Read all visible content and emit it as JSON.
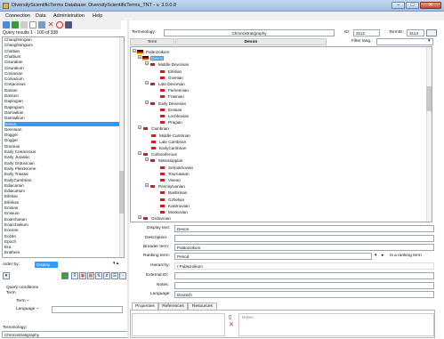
{
  "window": {
    "title": "DiversityScientificTerms  Database: DiversityScientificTerms_TNT  -  v. 3.0.0.8"
  },
  "menu": {
    "items": [
      "Connection",
      "Data",
      "Administration",
      "Help"
    ]
  },
  "query": {
    "results_label": "Query results  1 - 100 of 338",
    "items": [
      "Changhsingian",
      "Changhsingium",
      "Chattian",
      "Chattium",
      "Cisuralian",
      "Cisuralium",
      "Coniacian",
      "Coniacium",
      "Cretaceous",
      "Danian",
      "Danium",
      "Dapingian",
      "Dapingium",
      "Darriwilian",
      "Darriwilium",
      "Devon",
      "Devonian",
      "Dogger",
      "Dogger",
      "Drumian",
      "Early Cretaceous",
      "Early Jurassic",
      "Early Ordovician",
      "Early Pleistocene",
      "Early Triassic",
      "EarlyCambrian",
      "Ediacarian",
      "Ediacarium",
      "Eifelian",
      "Eifelium",
      "Emsian",
      "Emsium",
      "Eoarchaean",
      "Eoarchaikum",
      "Eocene",
      "Eozän",
      "Epoch",
      "Era",
      "Erathem"
    ],
    "selected": "Devon",
    "order_by_label": "order by:",
    "order_by_value": "Display Text",
    "conditions_label": "Query conditions",
    "term_label": "Term",
    "term_cond": "Term  ~",
    "language_cond": "Language  ~",
    "terminology_label": "Terminology:",
    "terminology_value": "Chronostratigraphy"
  },
  "header": {
    "terminology_label": "Terminology:",
    "terminology_value": "Chronostratigraphy",
    "id_label": "ID:",
    "id_value": "3112",
    "termid_label": "TermID:",
    "termid_value": "3113",
    "term_label": "Term",
    "term_value": "Devon",
    "filter_label": "Filter lang.:"
  },
  "tree": [
    {
      "label": "Paläozoikum",
      "depth": 0,
      "expander": "−",
      "flag": "de",
      "selected": false
    },
    {
      "label": "Devon",
      "depth": 1,
      "expander": "−",
      "flag": "de",
      "selected": true
    },
    {
      "label": "Middle Devonian",
      "depth": 2,
      "expander": "−",
      "flag": "gb",
      "selected": false
    },
    {
      "label": "Eifelian",
      "depth": 3,
      "expander": "",
      "flag": "gb",
      "selected": false
    },
    {
      "label": "Givetian",
      "depth": 3,
      "expander": "",
      "flag": "gb",
      "selected": false
    },
    {
      "label": "Late Devonian",
      "depth": 2,
      "expander": "−",
      "flag": "gb",
      "selected": false
    },
    {
      "label": "Famennian",
      "depth": 3,
      "expander": "",
      "flag": "gb",
      "selected": false
    },
    {
      "label": "Frasnian",
      "depth": 3,
      "expander": "",
      "flag": "gb",
      "selected": false
    },
    {
      "label": "Early Devonian",
      "depth": 2,
      "expander": "−",
      "flag": "gb",
      "selected": false
    },
    {
      "label": "Emsian",
      "depth": 3,
      "expander": "",
      "flag": "gb",
      "selected": false
    },
    {
      "label": "Lochkovian",
      "depth": 3,
      "expander": "",
      "flag": "gb",
      "selected": false
    },
    {
      "label": "Pragian",
      "depth": 3,
      "expander": "",
      "flag": "gb",
      "selected": false
    },
    {
      "label": "Cambrian",
      "depth": 1,
      "expander": "−",
      "flag": "gb",
      "selected": false
    },
    {
      "label": "Middle Cambrian",
      "depth": 2,
      "expander": "",
      "flag": "gb",
      "selected": false
    },
    {
      "label": "Late Cambrian",
      "depth": 2,
      "expander": "",
      "flag": "gb",
      "selected": false
    },
    {
      "label": "EarlyCambrian",
      "depth": 2,
      "expander": "",
      "flag": "gb",
      "selected": false
    },
    {
      "label": "Carboniferous",
      "depth": 1,
      "expander": "−",
      "flag": "gb",
      "selected": false
    },
    {
      "label": "Mississippian",
      "depth": 2,
      "expander": "−",
      "flag": "gb",
      "selected": false
    },
    {
      "label": "Serpukhovian",
      "depth": 3,
      "expander": "",
      "flag": "gb",
      "selected": false
    },
    {
      "label": "Tournaisian",
      "depth": 3,
      "expander": "",
      "flag": "gb",
      "selected": false
    },
    {
      "label": "Visean",
      "depth": 3,
      "expander": "",
      "flag": "gb",
      "selected": false
    },
    {
      "label": "Pennsylvanian",
      "depth": 2,
      "expander": "−",
      "flag": "gb",
      "selected": false
    },
    {
      "label": "Bashkirian",
      "depth": 3,
      "expander": "",
      "flag": "gb",
      "selected": false
    },
    {
      "label": "Gzhelian",
      "depth": 3,
      "expander": "",
      "flag": "gb",
      "selected": false
    },
    {
      "label": "Kasimovian",
      "depth": 3,
      "expander": "",
      "flag": "gb",
      "selected": false
    },
    {
      "label": "Moskovian",
      "depth": 3,
      "expander": "",
      "flag": "gb",
      "selected": false
    },
    {
      "label": "Ordovician",
      "depth": 1,
      "expander": "+",
      "flag": "gb",
      "selected": false
    }
  ],
  "details": {
    "display_text_label": "Display text:",
    "display_text_value": "Devon",
    "description_label": "Description:",
    "description_value": "",
    "broader_label": "Broader term:",
    "broader_value": "Paläozoikum",
    "ranking_label": "Ranking term:",
    "ranking_value": "Period",
    "ranking_suffix": "Is a ranking term",
    "hierarchy_label": "Hierarchy:",
    "hierarchy_value": "/ Paläozoikum",
    "external_label": "External ID:",
    "external_value": "",
    "notes_label": "Notes:",
    "notes_value": "",
    "language_label": "Language:",
    "language_value": "Deutsch"
  },
  "tabs": [
    "Properties",
    "References",
    "Resources"
  ],
  "panel": {
    "notes_placeholder": "Notes:"
  },
  "colors": {
    "selection": "#3399ff",
    "flag_gb": "#c8202e",
    "flag_de_black": "#000000",
    "flag_de_red": "#dd0000",
    "flag_de_gold": "#ffce00"
  }
}
